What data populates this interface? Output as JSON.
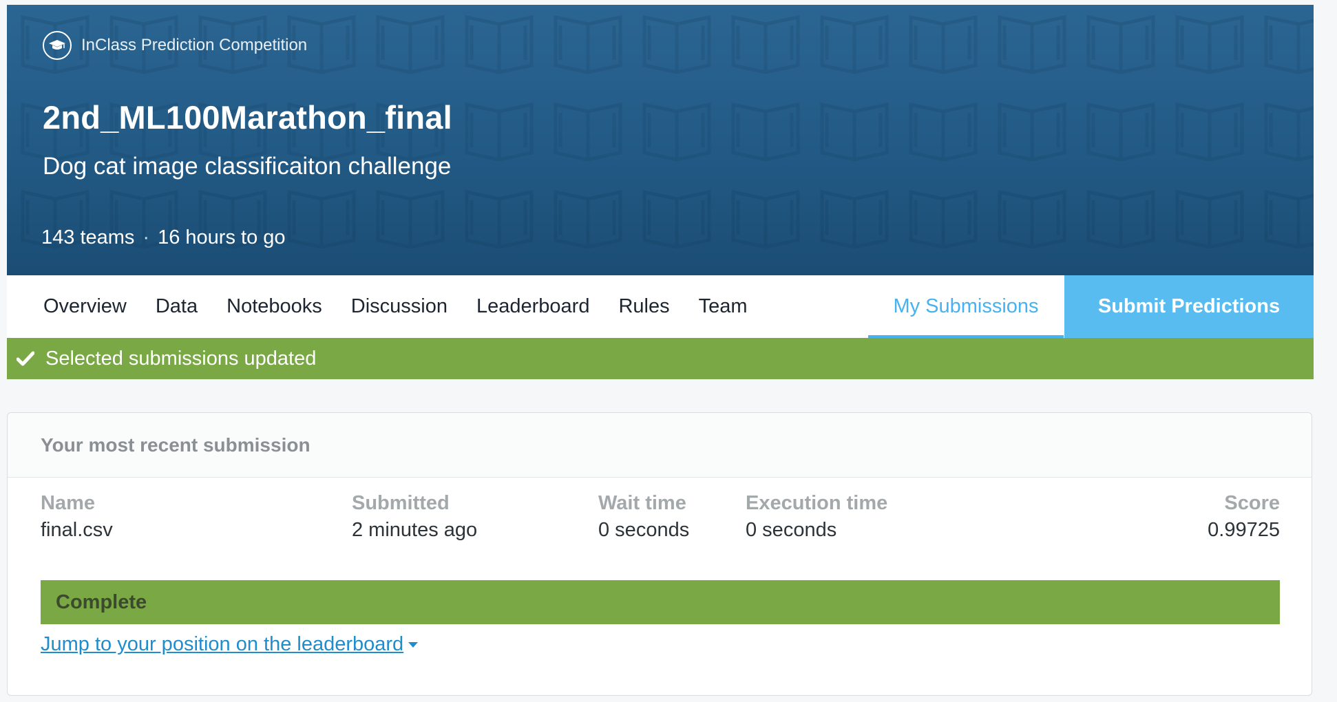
{
  "header": {
    "competition_type": "InClass Prediction Competition",
    "title": "2nd_ML100Marathon_final",
    "subtitle": "Dog cat image classificaiton challenge",
    "teams": "143 teams",
    "separator": "·",
    "time_left": "16 hours to go",
    "icon": "graduation-cap-icon",
    "banner_color": "#245b86"
  },
  "nav": {
    "tabs": [
      "Overview",
      "Data",
      "Notebooks",
      "Discussion",
      "Leaderboard",
      "Rules",
      "Team"
    ],
    "my_submissions": "My Submissions",
    "submit_predictions": "Submit Predictions",
    "accent_color": "#58bcf0"
  },
  "flash": {
    "icon": "checkmark-icon",
    "message": "Selected submissions updated",
    "color": "#7aa844"
  },
  "submission": {
    "heading": "Your most recent submission",
    "columns": {
      "name": {
        "label": "Name",
        "value": "final.csv"
      },
      "submitted": {
        "label": "Submitted",
        "value": "2 minutes ago"
      },
      "wait": {
        "label": "Wait time",
        "value": "0 seconds"
      },
      "execution": {
        "label": "Execution time",
        "value": "0 seconds"
      },
      "score": {
        "label": "Score",
        "value": "0.99725"
      }
    },
    "status": "Complete",
    "leaderboard_link": "Jump to your position on the leaderboard"
  }
}
